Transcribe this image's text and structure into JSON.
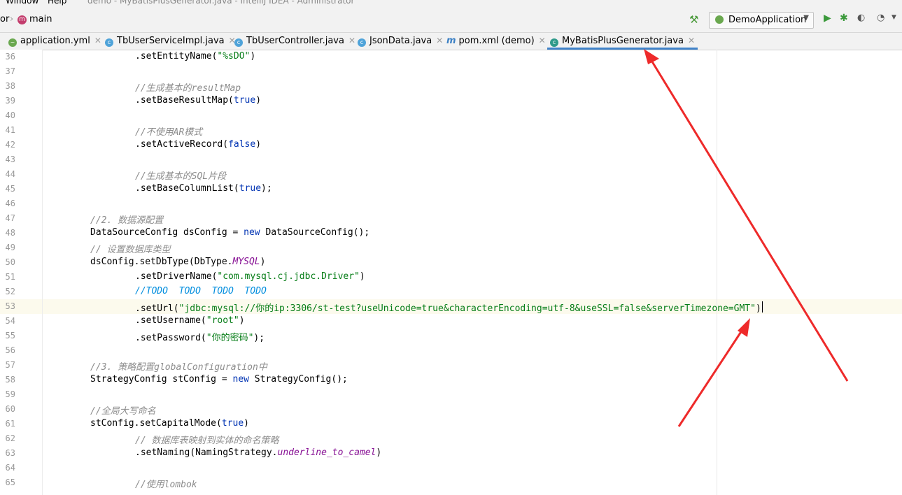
{
  "menu": {
    "window": "Window",
    "help": "Help",
    "title": "demo - MyBatisPlusGenerator.java - IntelliJ IDEA - Administrator"
  },
  "nav": {
    "crumb_prev": "or",
    "crumb_module": "main",
    "run_config": "DemoApplication"
  },
  "tabs": [
    {
      "label": "application.yml"
    },
    {
      "label": "TbUserServiceImpl.java"
    },
    {
      "label": "TbUserController.java"
    },
    {
      "label": "JsonData.java"
    },
    {
      "label": "pom.xml (demo)"
    },
    {
      "label": "MyBatisPlusGenerator.java",
      "active": true
    }
  ],
  "line_numbers": [
    "36",
    "37",
    "38",
    "39",
    "40",
    "41",
    "42",
    "43",
    "44",
    "45",
    "46",
    "47",
    "48",
    "49",
    "50",
    "51",
    "52",
    "53",
    "54",
    "55",
    "56",
    "57",
    "58",
    "59",
    "60",
    "61",
    "62",
    "63",
    "64",
    "65"
  ],
  "code": {
    "l36": {
      "a": ".setEntityName(",
      "s": "\"%sDO\"",
      "b": ")"
    },
    "l38": "//生成基本的resultMap",
    "l39": {
      "a": ".setBaseResultMap(",
      "k": "true",
      "b": ")"
    },
    "l41": "//不使用AR模式",
    "l42": {
      "a": ".setActiveRecord(",
      "k": "false",
      "b": ")"
    },
    "l44": "//生成基本的SQL片段",
    "l45": {
      "a": ".setBaseColumnList(",
      "k": "true",
      "b": ");"
    },
    "l47": "//2. 数据源配置",
    "l48": {
      "a": "DataSourceConfig dsConfig = ",
      "k": "new",
      "b": " DataSourceConfig();"
    },
    "l49": "// 设置数据库类型",
    "l50": {
      "a": "dsConfig.setDbType(DbType.",
      "c": "MYSQL",
      "b": ")"
    },
    "l51": {
      "a": ".setDriverName(",
      "s": "\"com.mysql.cj.jdbc.Driver\"",
      "b": ")"
    },
    "l52": {
      "a": "//",
      "t": "TODO  TODO  TODO  TODO"
    },
    "l53": {
      "a": ".setUrl(",
      "s": "\"jdbc:mysql://你的ip:3306/st-test?useUnicode=true&characterEncoding=utf-8&useSSL=false&serverTimezone=GMT\"",
      "b": ")"
    },
    "l54": {
      "a": ".setUsername(",
      "s": "\"root\"",
      "b": ")"
    },
    "l55": {
      "a": ".setPassword(",
      "s": "\"你的密码\"",
      "b": ");"
    },
    "l57": "//3. 策略配置globalConfiguration中",
    "l58": {
      "a": "StrategyConfig stConfig = ",
      "k": "new",
      "b": " StrategyConfig();"
    },
    "l60": "//全局大写命名",
    "l61": {
      "a": "stConfig.setCapitalMode(",
      "k": "true",
      "b": ")"
    },
    "l62": "// 数据库表映射到实体的命名策略",
    "l63": {
      "a": ".setNaming(NamingStrategy.",
      "c": "underline_to_camel",
      "b": ")"
    },
    "l65": "//使用lombok"
  },
  "colors": {
    "arrow": "#ee2a2a",
    "active_tab": "#4083c9",
    "string": "#067d17",
    "keyword": "#0033b3",
    "comment": "#8c8c8c"
  }
}
